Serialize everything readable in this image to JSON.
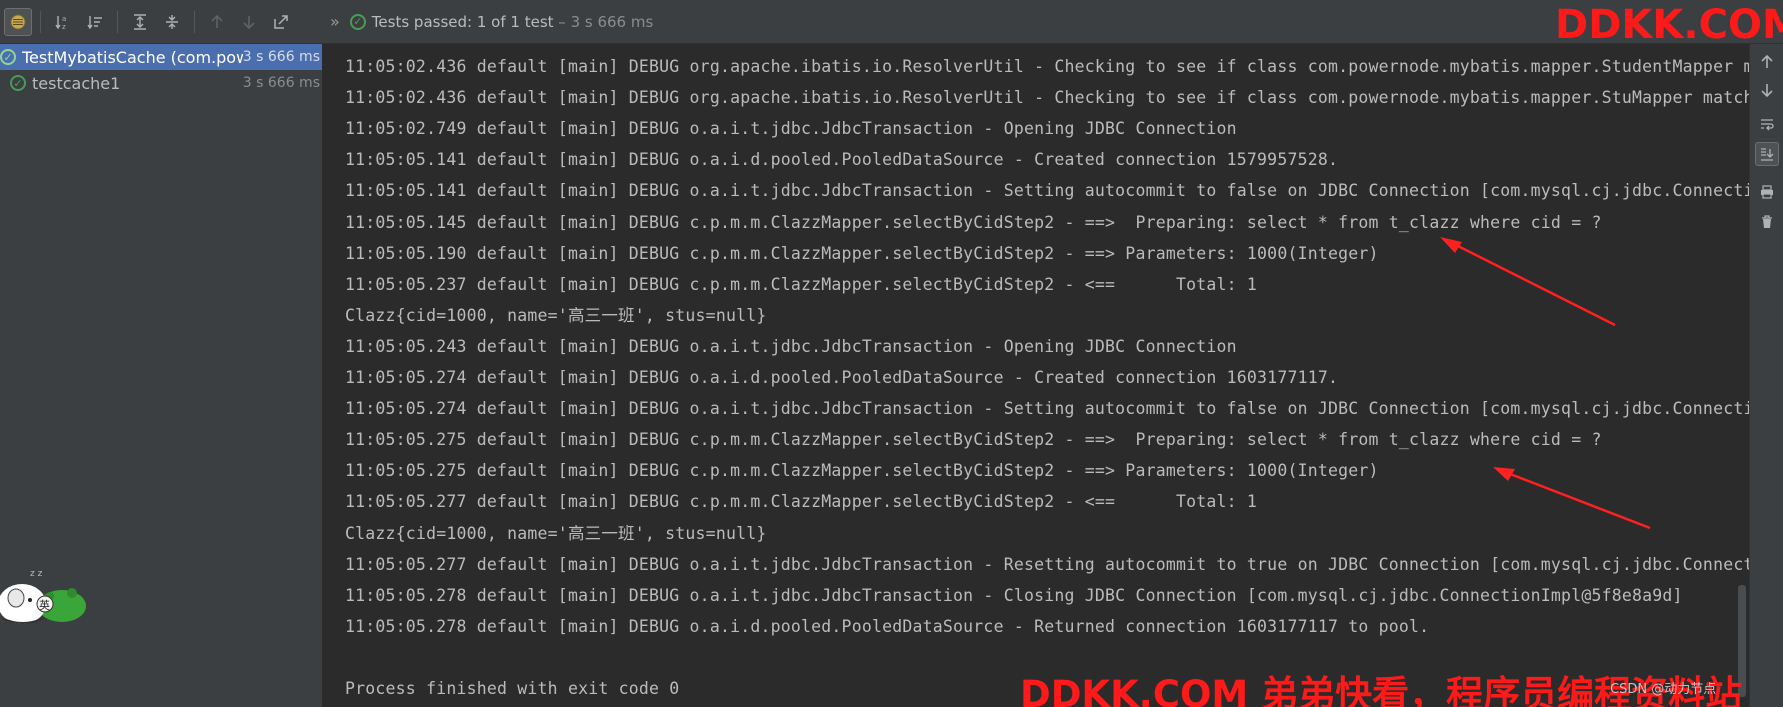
{
  "toolbar": {
    "buttons": [
      {
        "icon": "show-passed-icon",
        "active": true
      },
      {
        "icon": "sort-alpha-icon"
      },
      {
        "icon": "sort-duration-icon"
      },
      {
        "icon": "expand-all-icon"
      },
      {
        "icon": "collapse-all-icon"
      },
      {
        "icon": "previous-failed-icon"
      },
      {
        "icon": "next-failed-icon"
      },
      {
        "icon": "export-icon"
      }
    ],
    "more_glyph": "»"
  },
  "status": {
    "label": "Tests passed:",
    "count": "1 of 1 test",
    "duration": "– 3 s 666 ms"
  },
  "test_tree": [
    {
      "name": "TestMybatisCache (com.powernode",
      "time": "3 s 666 ms",
      "selected": true
    },
    {
      "name": "testcache1",
      "time": "3 s 666 ms",
      "selected": false
    }
  ],
  "console_lines": [
    "11:05:02.436 default [main] DEBUG org.apache.ibatis.io.ResolverUtil - Checking to see if class com.powernode.mybatis.mapper.StudentMapper matches",
    "11:05:02.436 default [main] DEBUG org.apache.ibatis.io.ResolverUtil - Checking to see if class com.powernode.mybatis.mapper.StuMapper matches",
    "11:05:02.749 default [main] DEBUG o.a.i.t.jdbc.JdbcTransaction - Opening JDBC Connection",
    "11:05:05.141 default [main] DEBUG o.a.i.d.pooled.PooledDataSource - Created connection 1579957528.",
    "11:05:05.141 default [main] DEBUG o.a.i.t.jdbc.JdbcTransaction - Setting autocommit to false on JDBC Connection [com.mysql.cj.jdbc.ConnectionImpl",
    "11:05:05.145 default [main] DEBUG c.p.m.m.ClazzMapper.selectByCidStep2 - ==>  Preparing: select * from t_clazz where cid = ?",
    "11:05:05.190 default [main] DEBUG c.p.m.m.ClazzMapper.selectByCidStep2 - ==> Parameters: 1000(Integer)",
    "11:05:05.237 default [main] DEBUG c.p.m.m.ClazzMapper.selectByCidStep2 - <==      Total: 1",
    "Clazz{cid=1000, name='高三一班', stus=null}",
    "11:05:05.243 default [main] DEBUG o.a.i.t.jdbc.JdbcTransaction - Opening JDBC Connection",
    "11:05:05.274 default [main] DEBUG o.a.i.d.pooled.PooledDataSource - Created connection 1603177117.",
    "11:05:05.274 default [main] DEBUG o.a.i.t.jdbc.JdbcTransaction - Setting autocommit to false on JDBC Connection [com.mysql.cj.jdbc.ConnectionImpl",
    "11:05:05.275 default [main] DEBUG c.p.m.m.ClazzMapper.selectByCidStep2 - ==>  Preparing: select * from t_clazz where cid = ?",
    "11:05:05.275 default [main] DEBUG c.p.m.m.ClazzMapper.selectByCidStep2 - ==> Parameters: 1000(Integer)",
    "11:05:05.277 default [main] DEBUG c.p.m.m.ClazzMapper.selectByCidStep2 - <==      Total: 1",
    "Clazz{cid=1000, name='高三一班', stus=null}",
    "11:05:05.277 default [main] DEBUG o.a.i.t.jdbc.JdbcTransaction - Resetting autocommit to true on JDBC Connection [com.mysql.cj.jdbc.ConnectionImpl",
    "11:05:05.278 default [main] DEBUG o.a.i.t.jdbc.JdbcTransaction - Closing JDBC Connection [com.mysql.cj.jdbc.ConnectionImpl@5f8e8a9d]",
    "11:05:05.278 default [main] DEBUG o.a.i.d.pooled.PooledDataSource - Returned connection 1603177117 to pool.",
    "",
    "Process finished with exit code 0"
  ],
  "gutter_buttons": [
    {
      "icon": "scroll-up-icon"
    },
    {
      "icon": "scroll-down-icon"
    },
    {
      "icon": "soft-wrap-icon"
    },
    {
      "icon": "scroll-to-end-icon",
      "active": true
    },
    {
      "icon": "print-icon"
    },
    {
      "icon": "clear-all-icon"
    }
  ],
  "overlays": {
    "watermark_top": "DDKK.COM",
    "watermark_bottom": "DDKK.COM 弟弟快看，程序员编程资料站",
    "csdn_tag": "CSDN @动力节点",
    "mascot_label": "英"
  },
  "colors": {
    "panel_bg": "#3c3f41",
    "console_bg": "#2b2b2b",
    "console_text": "#bbbbbb",
    "selection": "#4b6eaf",
    "pass_green": "#499c54",
    "watermark_red": "#ff1a1a"
  }
}
